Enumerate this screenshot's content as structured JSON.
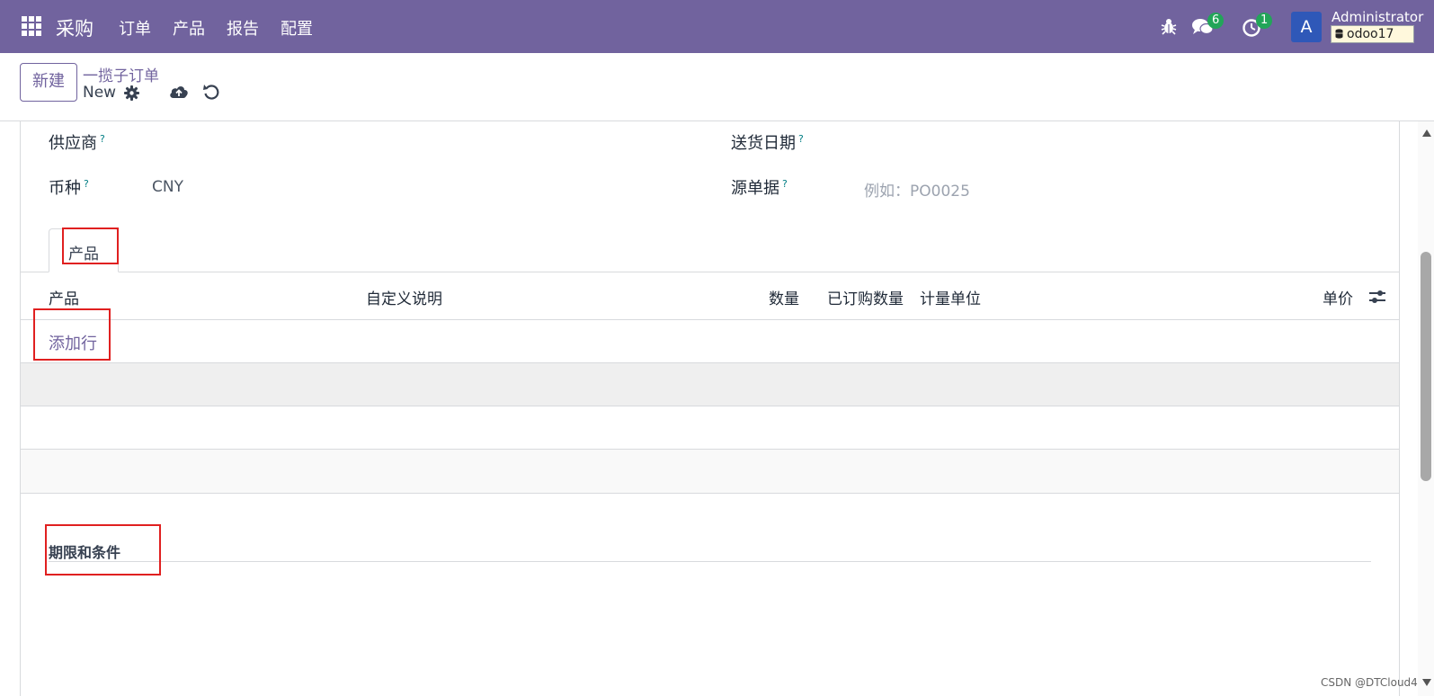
{
  "navbar": {
    "app_name": "采购",
    "menu": [
      "订单",
      "产品",
      "报告",
      "配置"
    ],
    "messages_count": "6",
    "activities_count": "1",
    "avatar_letter": "A",
    "user_name": "Administrator",
    "database": "odoo17",
    "color": "#71639e"
  },
  "control_panel": {
    "new_button": "新建",
    "breadcrumb_parent": "一揽子订单",
    "breadcrumb_current": "New"
  },
  "form": {
    "vendor_label": "供应商",
    "delivery_date_label": "送货日期",
    "currency_label": "币种",
    "currency_value": "CNY",
    "source_document_label": "源单据",
    "source_document_placeholder": "例如：PO0025",
    "help_mark": "?"
  },
  "tabs": [
    {
      "label": "产品",
      "active": true
    }
  ],
  "lines_table": {
    "columns": [
      "产品",
      "自定义说明",
      "数量",
      "已订购数量",
      "计量单位",
      "单价"
    ],
    "add_line": "添加行",
    "empty_rows": 3
  },
  "terms_section": {
    "title": "期限和条件"
  },
  "watermark": "CSDN @DTCloud4",
  "highlight_color": "#e02020"
}
